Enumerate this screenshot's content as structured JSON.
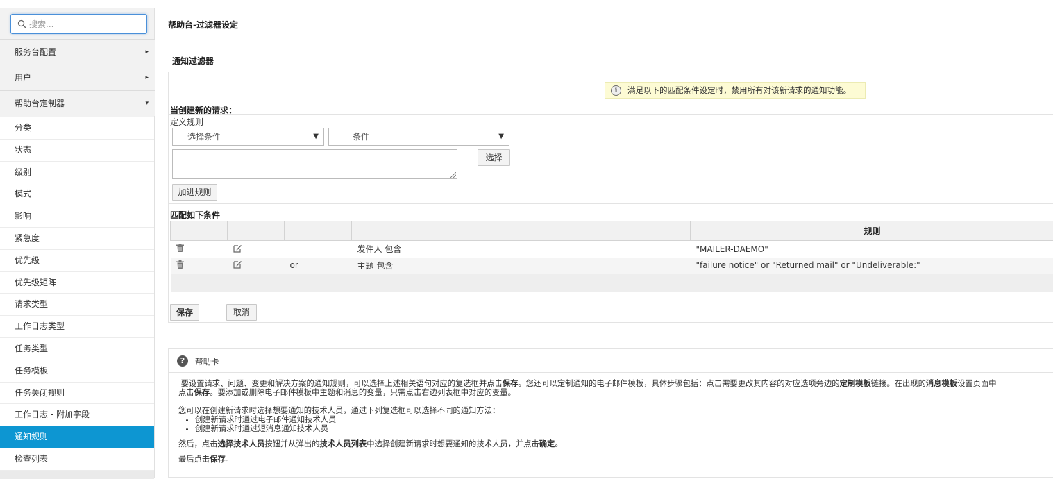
{
  "sidebar": {
    "search_placeholder": "搜索...",
    "groups": [
      {
        "label": "服务台配置",
        "arrow": "▸"
      },
      {
        "label": "用户",
        "arrow": "▸"
      },
      {
        "label": "帮助台定制器",
        "arrow": "▾"
      }
    ],
    "items": [
      {
        "label": "分类"
      },
      {
        "label": "状态"
      },
      {
        "label": "级别"
      },
      {
        "label": "模式"
      },
      {
        "label": "影响"
      },
      {
        "label": "紧急度"
      },
      {
        "label": "优先级"
      },
      {
        "label": "优先级矩阵"
      },
      {
        "label": "请求类型"
      },
      {
        "label": "工作日志类型"
      },
      {
        "label": "任务类型"
      },
      {
        "label": "任务模板"
      },
      {
        "label": "任务关闭规则"
      },
      {
        "label": "工作日志 - 附加字段"
      },
      {
        "label": "通知规则",
        "active": true
      },
      {
        "label": "检查列表"
      }
    ]
  },
  "main": {
    "page_title": "帮助台-过滤器设定",
    "section_title": "通知过滤器",
    "info_text": "满足以下的匹配条件设定时，禁用所有对该新请求的通知功能。",
    "when_label": "当创建新的请求：",
    "define_label": "定义规则",
    "select_condition": "---选择条件---",
    "select_criteria": "------条件------",
    "choose_button": "选择",
    "add_rule_button": "加进规则",
    "match_label": "匹配如下条件",
    "table": {
      "rule_header": "规则",
      "rows": [
        {
          "op": "",
          "criteria": "发件人 包含",
          "value": "\"MAILER-DAEMO\""
        },
        {
          "op": "or",
          "criteria": "主题 包含",
          "value": "\"failure notice\" or \"Returned mail\" or \"Undeliverable:\""
        }
      ]
    },
    "save_button": "保存",
    "cancel_button": "取消"
  },
  "help": {
    "title": "帮助卡",
    "p1a": "要设置请求、问题、变更和解决方案的通知规则，可以选择上述相关语句对应的复选框并点击",
    "p1b": "保存",
    "p1c": "。您还可以定制通知的电子邮件模板，具体步骤包括：点击需要更改其内容的对应选项旁边的",
    "p1d": "定制模板",
    "p1e": "链接。在出现的",
    "p1f": "消息模板",
    "p1g": "设置页面中",
    "p2a": "点击",
    "p2b": "保存",
    "p2c": "。要添加或删除电子邮件模板中主题和消息的变量，只需点击右边列表框中对应的变量。",
    "p3": "您可以在创建新请求时选择想要通知的技术人员，通过下列复选框可以选择不同的通知方法：",
    "bullets": [
      "创建新请求时通过电子邮件通知技术人员",
      "创建新请求时通过短消息通知技术人员"
    ],
    "p4a": "然后，点击",
    "p4b": "选择技术人员",
    "p4c": "按钮并从弹出的",
    "p4d": "技术人员列表",
    "p4e": "中选择创建新请求时想要通知的技术人员，并点击",
    "p4f": "确定",
    "p4g": "。",
    "p5a": "最后点击",
    "p5b": "保存",
    "p5c": "。"
  }
}
